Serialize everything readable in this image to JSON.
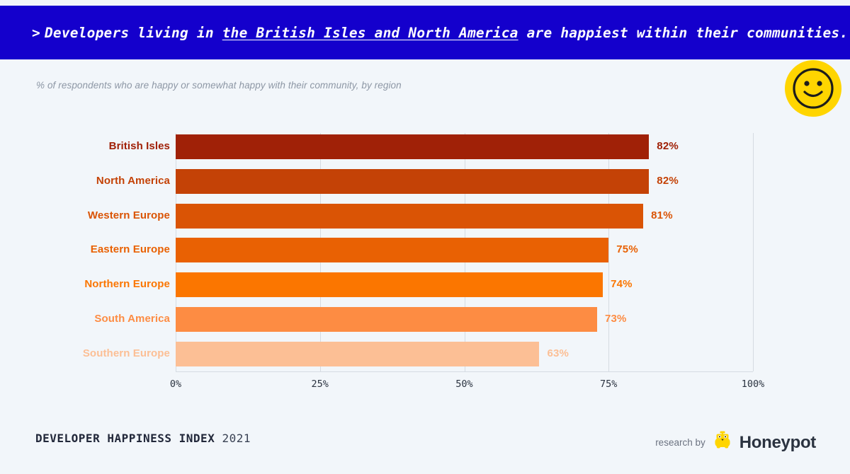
{
  "header": {
    "prefix": ">",
    "text_before": "Developers living in",
    "text_highlight": "the British Isles and North America",
    "text_after": "are happiest within their communities.",
    "background_color": "#1400cc",
    "text_color": "#ffffff"
  },
  "badge": {
    "icon": "smiley-face-icon",
    "fill_color": "#ffd500",
    "stroke_color": "#1d1d1b"
  },
  "subtitle": "% of respondents who are happy or somewhat happy with their community, by region",
  "chart_data": {
    "type": "bar",
    "orientation": "horizontal",
    "title": "> Developers living in the British Isles and North America are happiest within their communities.",
    "subtitle": "% of respondents who are happy or somewhat happy with their community, by region",
    "xlabel": "",
    "ylabel": "",
    "xlim": [
      0,
      100
    ],
    "grid": true,
    "legend": "none",
    "categories": [
      "British Isles",
      "North America",
      "Western Europe",
      "Eastern Europe",
      "Northern Europe",
      "South America",
      "Southern Europe"
    ],
    "values": [
      82,
      82,
      81,
      75,
      74,
      73,
      63
    ],
    "value_labels": [
      "82%",
      "82%",
      "81%",
      "75%",
      "74%",
      "73%",
      "63%"
    ],
    "colors": [
      "#a02107",
      "#c44206",
      "#da5405",
      "#e96103",
      "#fb7600",
      "#fd8c43",
      "#fcbf95"
    ],
    "tick_labels": [
      "0%",
      "25%",
      "50%",
      "75%",
      "100%"
    ],
    "tick_values": [
      0,
      25,
      50,
      75,
      100
    ],
    "gridline_color": "#d5dbe2",
    "background_color": "#f2f6fa"
  },
  "footer": {
    "title_strong": "DEVELOPER HAPPINESS INDEX",
    "title_year": "2021",
    "credit_text": "research by",
    "brand_name": "Honeypot",
    "brand_icon": "honeypot-bear-icon",
    "brand_icon_color": "#ffd500"
  }
}
